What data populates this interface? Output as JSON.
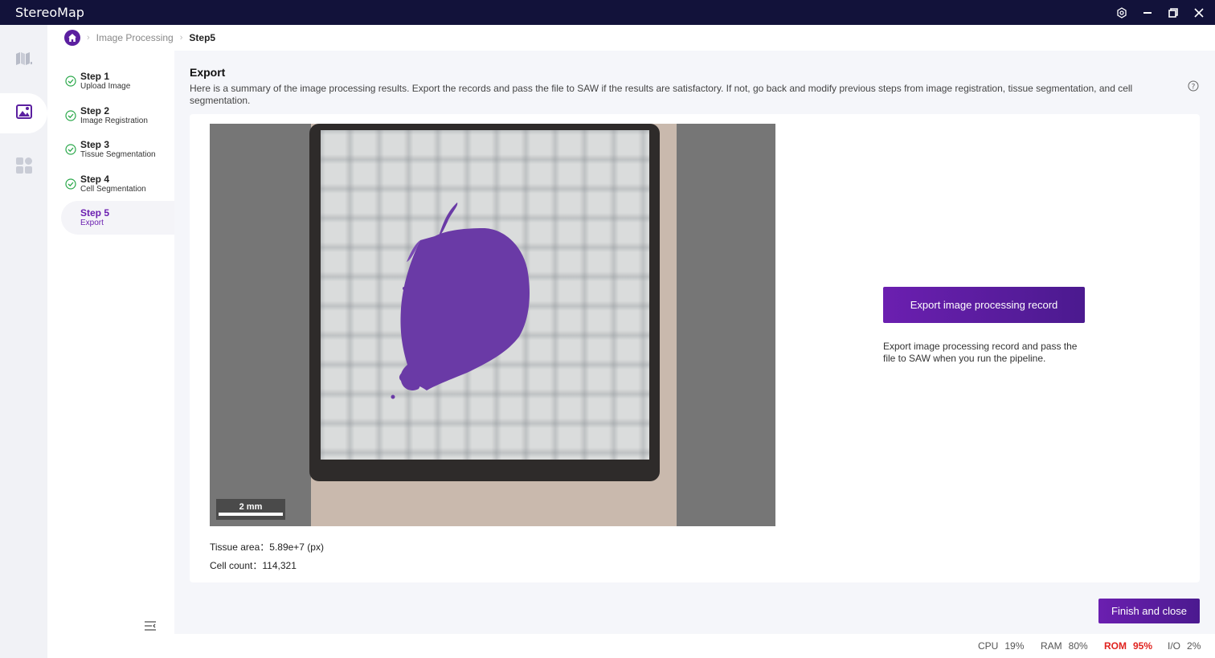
{
  "app": {
    "title": "StereoMap"
  },
  "window_controls": [
    "settings-icon",
    "minimize-icon",
    "restore-icon",
    "close-icon"
  ],
  "rail": {
    "items": [
      "map-icon",
      "image-icon",
      "apps-icon"
    ],
    "active": "image-icon"
  },
  "breadcrumb": {
    "items": [
      "Image Processing"
    ],
    "current": "Step5"
  },
  "steps": [
    {
      "title": "Step 1",
      "subtitle": "Upload Image",
      "status": "done"
    },
    {
      "title": "Step 2",
      "subtitle": "Image Registration",
      "status": "done"
    },
    {
      "title": "Step 3",
      "subtitle": "Tissue Segmentation",
      "status": "done"
    },
    {
      "title": "Step 4",
      "subtitle": "Cell Segmentation",
      "status": "done"
    },
    {
      "title": "Step 5",
      "subtitle": "Export",
      "status": "active"
    }
  ],
  "main": {
    "title": "Export",
    "description": "Here is a summary of the image processing results. Export the records and pass the file to SAW if the results are satisfactory. If not, go back and modify previous steps from image registration, tissue segmentation, and cell segmentation.",
    "scalebar_label": "2 mm",
    "stats": {
      "tissue_area_label": "Tissue area：",
      "tissue_area_value": "5.89e+7 (px)",
      "cell_count_label": "Cell count：",
      "cell_count_value": "114,321"
    },
    "export_button": "Export image processing record",
    "export_description": "Export image processing record and pass the file to SAW when you run the pipeline.",
    "finish_button": "Finish and close"
  },
  "status": [
    {
      "label": "CPU",
      "value": "19%",
      "alert": false
    },
    {
      "label": "RAM",
      "value": "80%",
      "alert": false
    },
    {
      "label": "ROM",
      "value": "95%",
      "alert": true
    },
    {
      "label": "I/O",
      "value": "2%",
      "alert": false
    }
  ],
  "colors": {
    "accent": "#6b1fb0",
    "titlebar": "#12123a",
    "alert": "#e0231f",
    "tissue": "#6a3aa6"
  }
}
